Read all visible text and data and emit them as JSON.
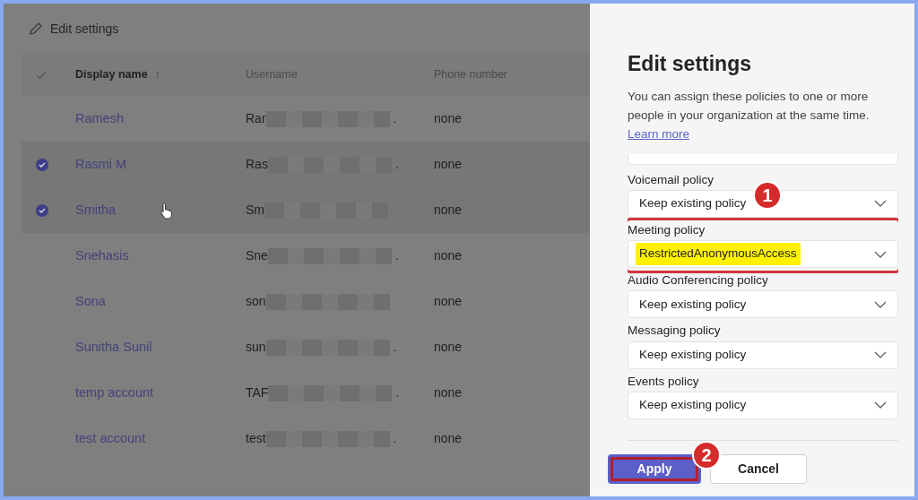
{
  "toolbar": {
    "label": "Edit settings"
  },
  "table": {
    "columns": [
      {
        "label": "Display name",
        "sort_arrow": "↑"
      },
      {
        "label": "Username"
      },
      {
        "label": "Phone number"
      }
    ],
    "rows": [
      {
        "selected": false,
        "name": "Ramesh",
        "username": "Rar",
        "username_end": ".",
        "phone": "none"
      },
      {
        "selected": true,
        "name": "Rasmi M",
        "username": "Ras",
        "username_end": ".",
        "phone": "none"
      },
      {
        "selected": true,
        "name": "Smitha",
        "username": "Sm",
        "phone": "none"
      },
      {
        "selected": false,
        "name": "Snehasis",
        "username": "Sne",
        "username_end": ".",
        "phone": "none"
      },
      {
        "selected": false,
        "name": "Sona",
        "username": "son",
        "phone": "none"
      },
      {
        "selected": false,
        "name": "Sunitha Sunil",
        "username": "sun",
        "username_end": ".",
        "phone": "none"
      },
      {
        "selected": false,
        "name": "temp account",
        "username": "TAF",
        "username_end": ".",
        "phone": "none"
      },
      {
        "selected": false,
        "name": "test account",
        "username": "test",
        "username_end": ".",
        "phone": "none"
      }
    ]
  },
  "panel": {
    "title": "Edit settings",
    "description": "You can assign these policies to one or more people in your organization at the same time.",
    "learn_more": "Learn more",
    "fields": [
      {
        "label": "Voicemail policy",
        "value": "Keep existing policy",
        "annotation": "1"
      },
      {
        "label": "Meeting policy",
        "value": "RestrictedAnonymousAccess",
        "outlined": true,
        "highlighted": true
      },
      {
        "label": "Audio Conferencing policy",
        "value": "Keep existing policy"
      },
      {
        "label": "Messaging policy",
        "value": "Keep existing policy"
      },
      {
        "label": "Events policy",
        "value": "Keep existing policy"
      }
    ],
    "buttons": [
      {
        "label": "Apply",
        "kind": "primary",
        "outlined": true,
        "annotation": "2"
      },
      {
        "label": "Cancel",
        "kind": "secondary"
      }
    ]
  }
}
